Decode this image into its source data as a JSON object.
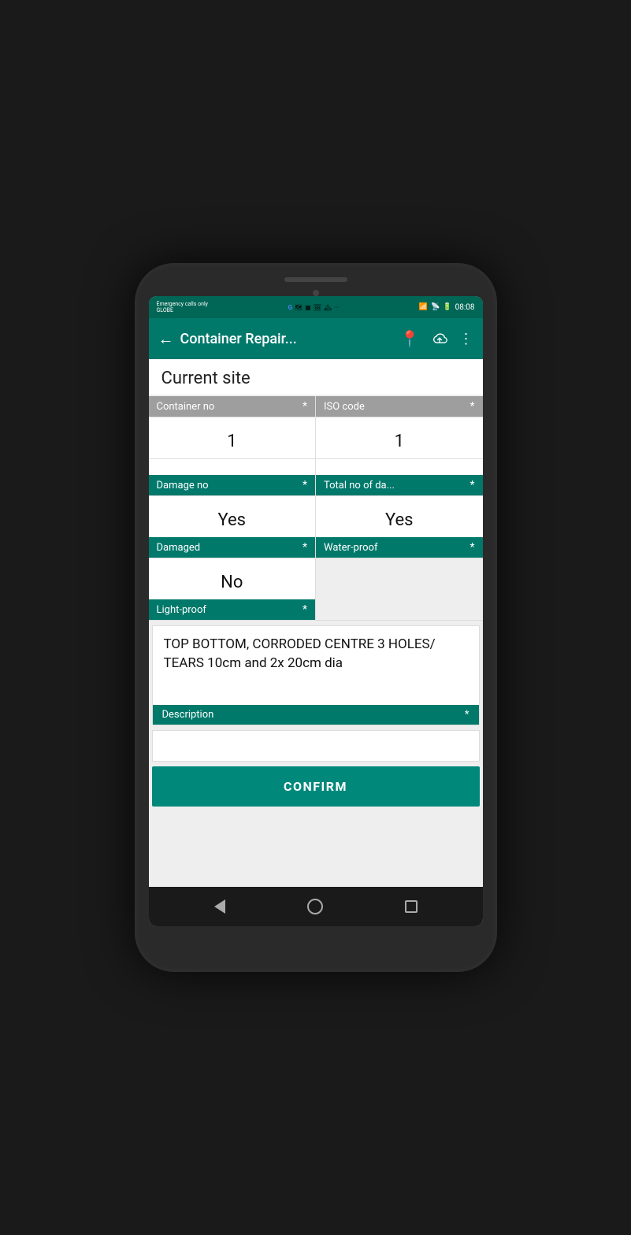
{
  "status_bar": {
    "carrier": "Emergency calls only",
    "network": "GLOBE",
    "time": "08:08",
    "google_icon": "G",
    "wifi": "WiFi",
    "signal": "Signal"
  },
  "app_bar": {
    "title": "Container Repair...",
    "back_label": "←",
    "menu_label": "⋮"
  },
  "page": {
    "site_label": "Current site"
  },
  "form": {
    "container_no_label": "Container no",
    "iso_code_label": "ISO code",
    "container_no_value": "1",
    "iso_code_value": "1",
    "damage_no_label": "Damage no",
    "total_damage_label": "Total no of da...",
    "damage_no_value": "",
    "total_damage_value": "",
    "damaged_label": "Damaged",
    "waterproof_label": "Water-proof",
    "damaged_value": "Yes",
    "waterproof_value": "Yes",
    "lightproof_label": "Light-proof",
    "lightproof_value": "No",
    "description_label": "Description",
    "description_value": "TOP BOTTOM, CORRODED CENTRE 3 HOLES/ TEARS 10cm and 2x 20cm dia",
    "required_marker": "*"
  },
  "confirm_button": {
    "label": "CONFIRM"
  },
  "bottom_nav": {
    "back": "back",
    "home": "home",
    "recent": "recent"
  }
}
